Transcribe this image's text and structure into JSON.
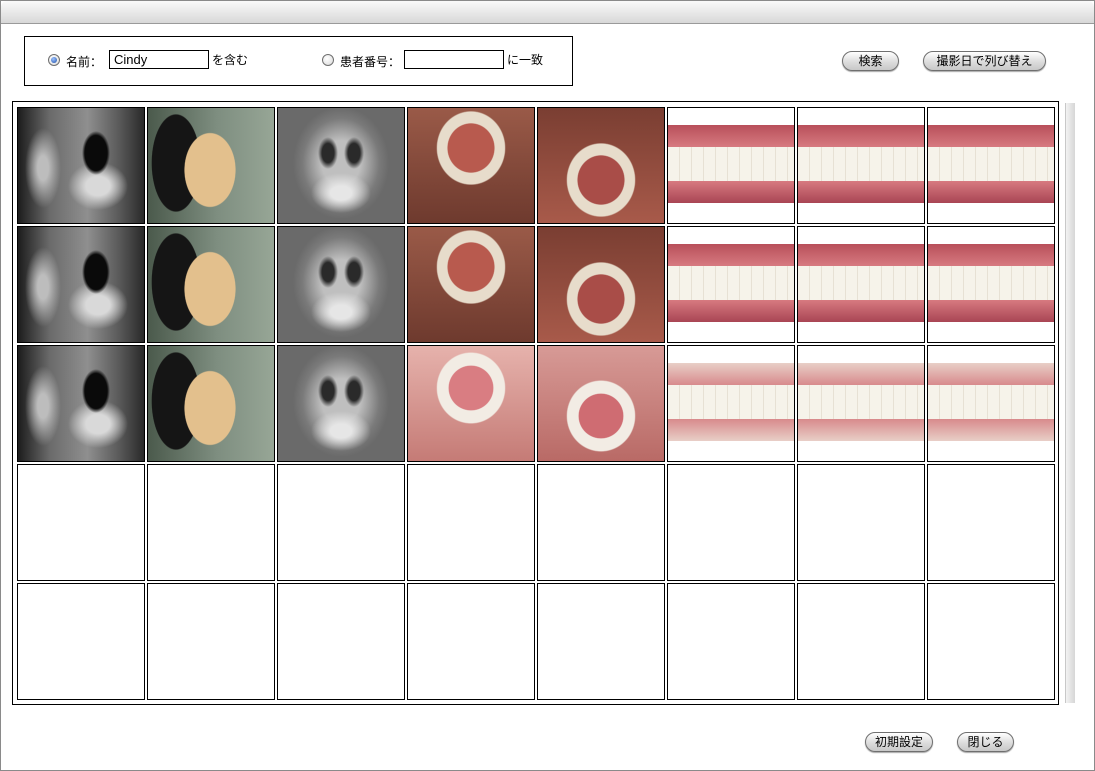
{
  "search": {
    "name_label": "名前：",
    "name_value": "Cindy",
    "contains_label": "を含む",
    "patient_no_label": "患者番号：",
    "patient_no_value": "",
    "match_label": "に一致",
    "selected_mode": "name"
  },
  "buttons": {
    "search": "検索",
    "sort_by_date": "撮影日で列び替え",
    "reset": "初期設定",
    "close": "閉じる"
  },
  "grid": {
    "columns": 8,
    "rows": [
      [
        "lateral-ceph-xray",
        "facial-profile-photo",
        "frontal-ceph-xray",
        "upper-occlusal-photo",
        "lower-occlusal-photo",
        "right-buccal-photo",
        "frontal-intraoral-photo",
        "left-buccal-photo"
      ],
      [
        "lateral-ceph-xray",
        "facial-profile-photo",
        "frontal-ceph-xray",
        "upper-occlusal-photo",
        "lower-occlusal-photo",
        "right-buccal-photo",
        "frontal-intraoral-photo",
        "left-buccal-photo"
      ],
      [
        "lateral-ceph-xray",
        "facial-profile-photo",
        "frontal-ceph-xray",
        "upper-occlusal-photo",
        "lower-occlusal-photo",
        "right-buccal-photo",
        "frontal-intraoral-photo",
        "left-buccal-photo"
      ],
      [
        "empty",
        "empty",
        "empty",
        "empty",
        "empty",
        "empty",
        "empty",
        "empty"
      ],
      [
        "empty",
        "empty",
        "empty",
        "empty",
        "empty",
        "empty",
        "empty",
        "empty"
      ]
    ]
  }
}
